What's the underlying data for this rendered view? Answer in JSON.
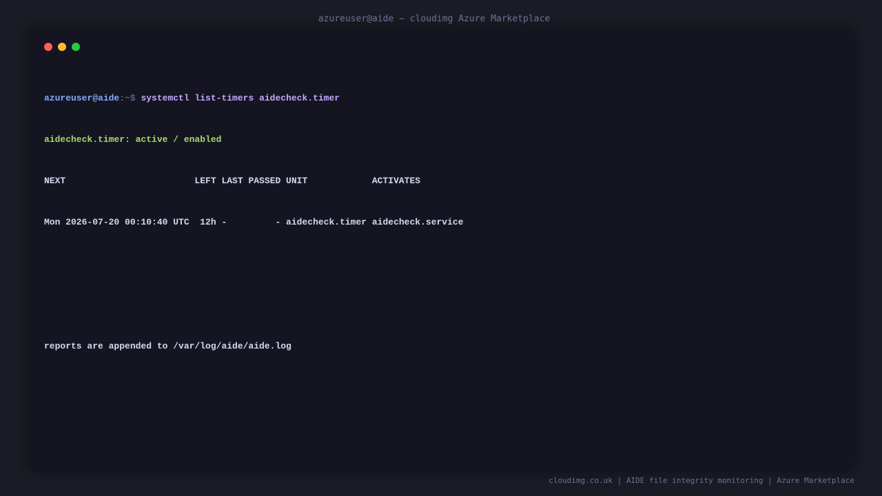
{
  "window": {
    "title": "azureuser@aide ~ cloudimg Azure Marketplace"
  },
  "terminal": {
    "prompt_user": "azureuser@aide",
    "prompt_path": ":~$",
    "command": "systemctl list-timers aidecheck.timer",
    "status_line": "aidecheck.timer: active / enabled",
    "header_line": "NEXT                        LEFT LAST PASSED UNIT            ACTIVATES",
    "row_line": "Mon 2026-07-20 00:10:40 UTC  12h -         - aidecheck.timer aidecheck.service",
    "report_line": "reports are appended to /var/log/aide/aide.log"
  },
  "footer": {
    "text": "cloudimg.co.uk | AIDE file integrity monitoring | Azure Marketplace"
  },
  "colors": {
    "background": "#1c1c26",
    "window": "#141520",
    "close": "#ff5f57",
    "minimize": "#febc2e",
    "maximize": "#28c840",
    "prompt_user": "#82aaff",
    "command": "#c3a6ff",
    "status_green": "#a6d96a",
    "output_text": "#d4d8ee"
  }
}
